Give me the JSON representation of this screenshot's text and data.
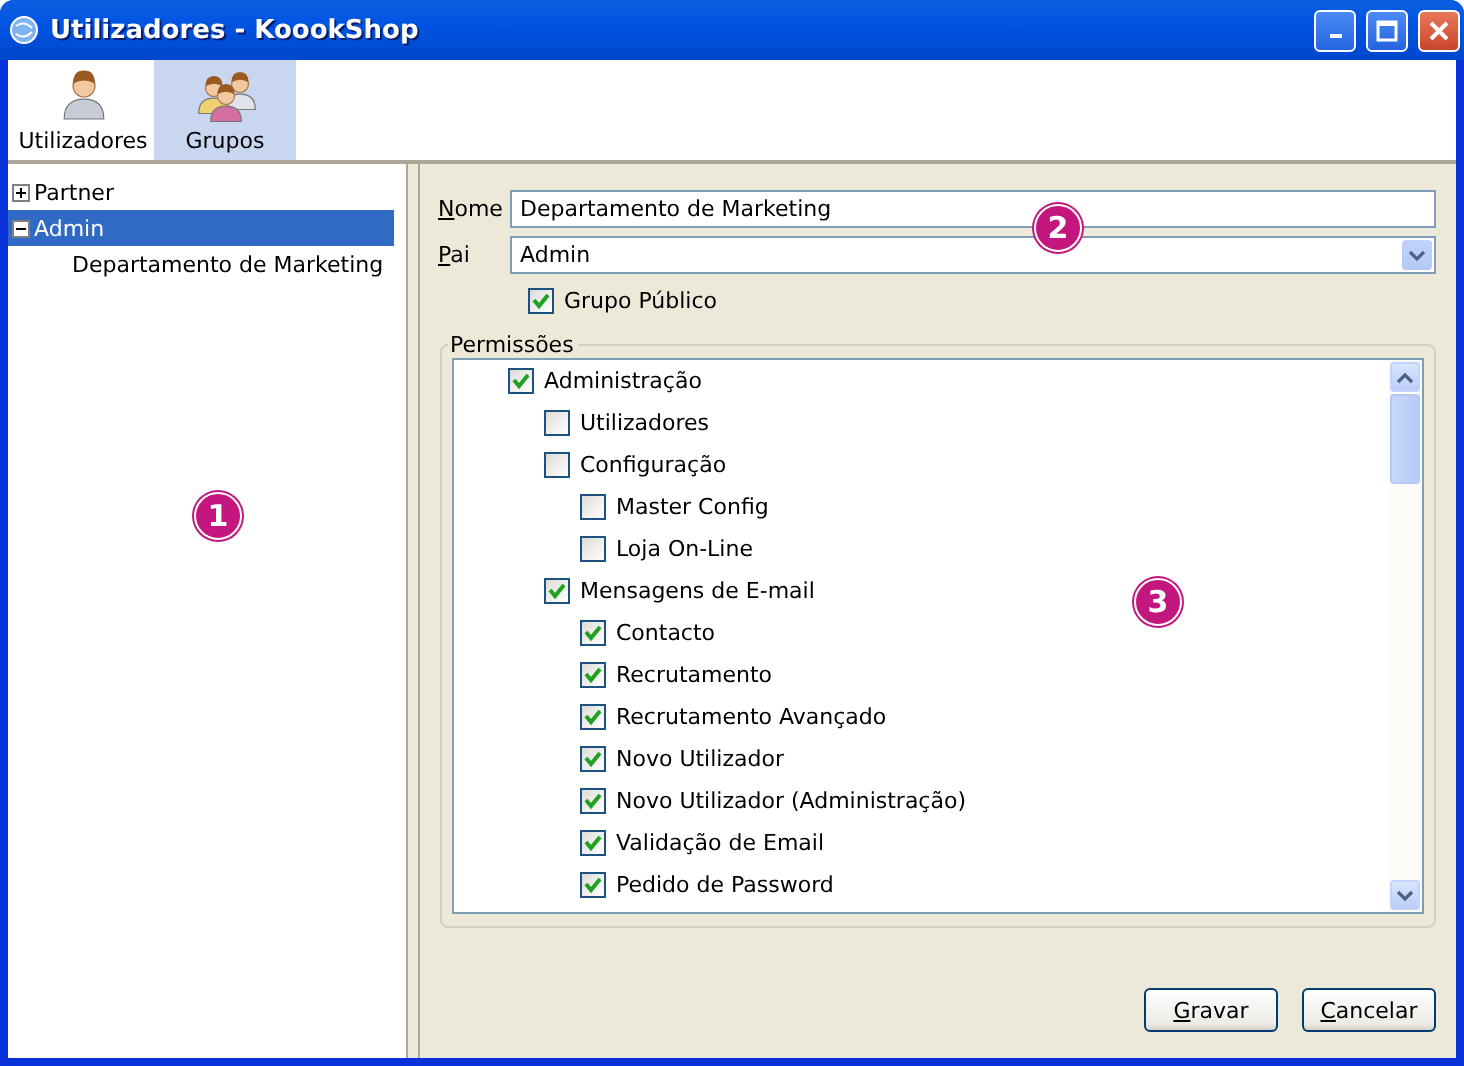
{
  "window": {
    "title": "Utilizadores - KoookShop"
  },
  "toolbar": [
    {
      "label": "Utilizadores",
      "kind": "user",
      "selected": false
    },
    {
      "label": "Grupos",
      "kind": "group",
      "selected": true
    }
  ],
  "group_tree": {
    "callout": "1",
    "items": [
      {
        "label": "Partner",
        "expanded": false,
        "selected": false
      },
      {
        "label": "Admin",
        "expanded": true,
        "selected": true,
        "children": [
          {
            "label": "Departamento de Marketing",
            "selected": false
          }
        ]
      }
    ]
  },
  "form": {
    "callout": "2",
    "name_label": "Nome",
    "name_value": "Departamento de Marketing",
    "parent_label": "Pai",
    "parent_value": "Admin",
    "public_label": "Grupo Público",
    "public_checked": true
  },
  "permissions": {
    "title": "Permissões",
    "callout": "3",
    "items": [
      {
        "label": "Administração",
        "checked": true,
        "children": [
          {
            "label": "Utilizadores",
            "checked": false
          },
          {
            "label": "Configuração",
            "checked": false,
            "children": [
              {
                "label": "Master Config",
                "checked": false
              },
              {
                "label": "Loja On-Line",
                "checked": false
              }
            ]
          },
          {
            "label": "Mensagens de E-mail",
            "checked": true,
            "children": [
              {
                "label": "Contacto",
                "checked": true
              },
              {
                "label": "Recrutamento",
                "checked": true
              },
              {
                "label": "Recrutamento Avançado",
                "checked": true
              },
              {
                "label": "Novo Utilizador",
                "checked": true
              },
              {
                "label": "Novo Utilizador (Administração)",
                "checked": true
              },
              {
                "label": "Validação de Email",
                "checked": true
              },
              {
                "label": "Pedido de Password",
                "checked": true
              }
            ]
          }
        ]
      }
    ]
  },
  "buttons": [
    "Gravar",
    "Cancelar"
  ]
}
